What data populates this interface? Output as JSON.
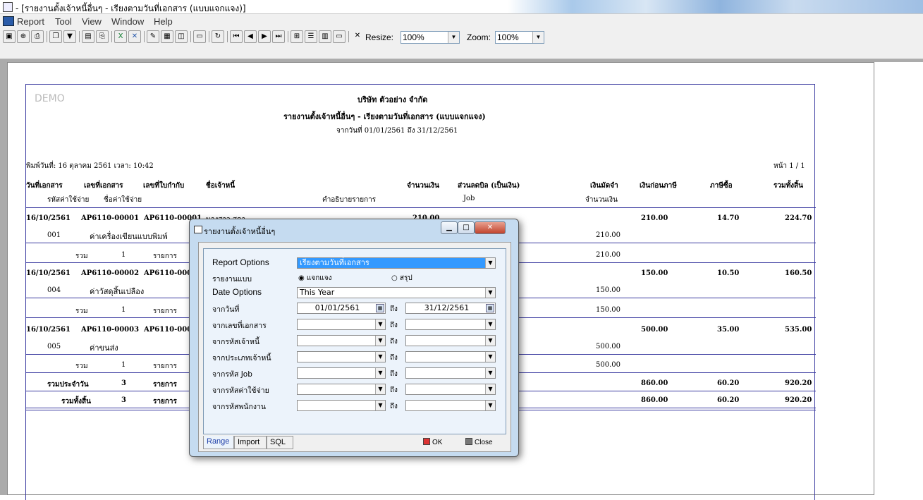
{
  "window": {
    "title": "- [รายงานตั้งเจ้าหนี้อื่นๆ - เรียงตามวันที่เอกสาร (แบบแจกแจง)]"
  },
  "menu": [
    "Report",
    "Tool",
    "View",
    "Window",
    "Help"
  ],
  "toolbar": {
    "icons": [
      "preview-icon",
      "zoom-icon",
      "print-icon",
      "copy-icon",
      "filter-icon",
      "save-icon",
      "export-icon",
      "excel-icon",
      "delete-icon",
      "paint-icon",
      "grid-icon",
      "fit-icon",
      "image-icon",
      "refresh-icon",
      "first-icon",
      "prev-icon",
      "next-icon",
      "last-icon",
      "layout-icon",
      "rows-icon",
      "columns-icon",
      "window-icon",
      "close-icon"
    ],
    "resize_label": "Resize:",
    "resize_value": "100%",
    "zoom_label": "Zoom:",
    "zoom_value": "100%"
  },
  "report": {
    "watermark": "DEMO",
    "company": "บริษัท ตัวอย่าง จำกัด",
    "title": "รายงานตั้งเจ้าหนี้อื่นๆ - เรียงตามวันที่เอกสาร (แบบแจกแจง)",
    "date_range": "จากวันที่ 01/01/2561 ถึง 31/12/2561",
    "printed": "พิมพ์วันที่: 16 ตุลาคม 2561 เวลา: 10:42",
    "page": "หน้า 1 / 1",
    "headers1": [
      "วันที่เอกสาร",
      "เลขที่เอกสาร",
      "เลขที่ใบกำกับ",
      "ชื่อเจ้าหนี้",
      "จำนวนเงิน",
      "ส่วนลดบิล (เป็นเงิน)",
      "เงินมัดจำ",
      "เงินก่อนภาษี",
      "ภาษีซื้อ",
      "รวมทั้งสิ้น"
    ],
    "headers2": [
      "รหัสค่าใช้จ่าย",
      "ชื่อค่าใช้จ่าย",
      "คำอธิบายรายการ",
      "Job",
      "จำนวนเงิน"
    ],
    "docs": [
      {
        "date": "16/10/2561",
        "doc": "AP6110-00001",
        "inv": "AP6110-00001",
        "creditor": "นางสาว สุดา",
        "amount": "210.00",
        "code": "001",
        "expense": "ค่าเครื่องเขียนแบบพิมพ์",
        "line_amount": "210.00",
        "before_tax": "210.00",
        "vat": "14.70",
        "total": "224.70",
        "sum_label": "รวม",
        "sum_count": "1",
        "sum_unit": "รายการ",
        "sum_amount": "210.00"
      },
      {
        "date": "16/10/2561",
        "doc": "AP6110-00002",
        "inv": "AP6110-00002",
        "creditor": "",
        "amount": "",
        "code": "004",
        "expense": "ค่าวัสดุสิ้นเปลือง",
        "line_amount": "150.00",
        "before_tax": "150.00",
        "vat": "10.50",
        "total": "160.50",
        "sum_label": "รวม",
        "sum_count": "1",
        "sum_unit": "รายการ",
        "sum_amount": "150.00"
      },
      {
        "date": "16/10/2561",
        "doc": "AP6110-00003",
        "inv": "AP6110-00003",
        "creditor": "",
        "amount": "",
        "code": "005",
        "expense": "ค่าขนส่ง",
        "line_amount": "500.00",
        "before_tax": "500.00",
        "vat": "35.00",
        "total": "535.00",
        "sum_label": "รวม",
        "sum_count": "1",
        "sum_unit": "รายการ",
        "sum_amount": "500.00"
      }
    ],
    "daily": {
      "label": "รวมประจำวัน",
      "count": "3",
      "unit": "รายการ",
      "before_tax": "860.00",
      "vat": "60.20",
      "total": "920.20"
    },
    "grand": {
      "label": "รวมทั้งสิ้น",
      "count": "3",
      "unit": "รายการ",
      "before_tax": "860.00",
      "vat": "60.20",
      "total": "920.20"
    }
  },
  "dialog": {
    "title": "รายงานตั้งเจ้าหนี้อื่นๆ",
    "report_options_label": "Report Options",
    "report_options_value": "เรียงตามวันที่เอกสาร",
    "type_label": "รายงานแบบ",
    "type_detail": "แจกแจง",
    "type_summary": "สรุป",
    "date_options_label": "Date Options",
    "date_options_value": "This Year",
    "from_date_label": "จากวันที่",
    "from_date": "01/01/2561",
    "to_label": "ถึง",
    "to_date": "31/12/2561",
    "ranges": [
      "จากเลขที่เอกสาร",
      "จากรหัสเจ้าหนี้",
      "จากประเภทเจ้าหนี้",
      "จากรหัส Job",
      "จากรหัสค่าใช้จ่าย",
      "จากรหัสพนักงาน"
    ],
    "tabs": [
      "Range",
      "Import",
      "SQL"
    ],
    "ok_label": "OK",
    "close_label": "Close"
  }
}
